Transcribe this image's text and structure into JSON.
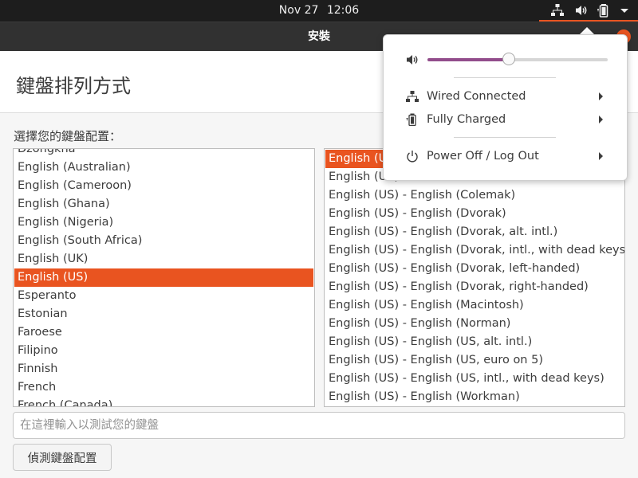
{
  "topbar": {
    "date": "Nov 27",
    "time": "12:06",
    "icons": [
      "network-icon",
      "volume-icon",
      "battery-icon",
      "dropdown-arrow-icon"
    ],
    "accent": "#e95420"
  },
  "window": {
    "title": "安裝"
  },
  "page": {
    "title": "鍵盤排列方式",
    "prompt": "選擇您的鍵盤配置："
  },
  "layouts": {
    "items": [
      "Dzongkha",
      "English (Australian)",
      "English (Cameroon)",
      "English (Ghana)",
      "English (Nigeria)",
      "English (South Africa)",
      "English (UK)",
      "English (US)",
      "Esperanto",
      "Estonian",
      "Faroese",
      "Filipino",
      "Finnish",
      "French",
      "French (Canada)"
    ],
    "selected": "English (US)"
  },
  "variants": {
    "items": [
      "English (US)",
      "English (US) - Cherokee",
      "English (US) - English (Colemak)",
      "English (US) - English (Dvorak)",
      "English (US) - English (Dvorak, alt. intl.)",
      "English (US) - English (Dvorak, intl., with dead keys)",
      "English (US) - English (Dvorak, left-handed)",
      "English (US) - English (Dvorak, right-handed)",
      "English (US) - English (Macintosh)",
      "English (US) - English (Norman)",
      "English (US) - English (US, alt. intl.)",
      "English (US) - English (US, euro on 5)",
      "English (US) - English (US, intl., with dead keys)",
      "English (US) - English (Workman)"
    ],
    "selected": "English (US)"
  },
  "test_input": {
    "placeholder": "在這裡輸入以測試您的鍵盤",
    "value": ""
  },
  "detect_button": {
    "label": "偵測鍵盤配置"
  },
  "system_menu": {
    "volume": {
      "icon": "volume-icon",
      "level": 0.45,
      "fill_color": "#924d8b"
    },
    "items": [
      {
        "icon": "network-icon",
        "label": "Wired Connected"
      },
      {
        "icon": "battery-icon",
        "label": "Fully Charged"
      },
      {
        "icon": "power-icon",
        "label": "Power Off / Log Out"
      }
    ]
  }
}
